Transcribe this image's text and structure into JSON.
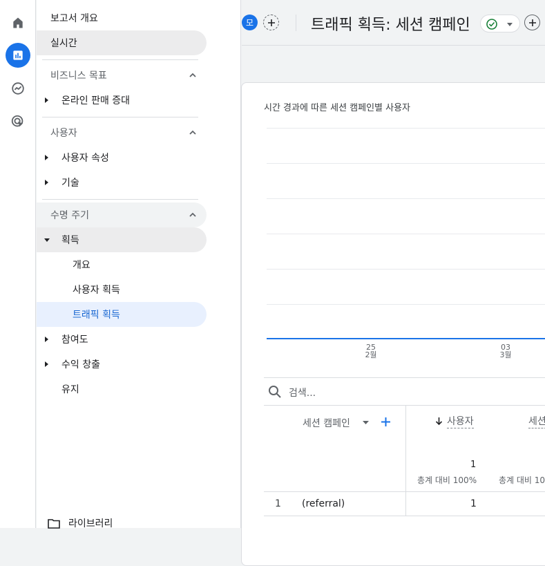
{
  "header": {
    "avatar_letter": "모",
    "title": "트래픽 획득: 세션 캠페인"
  },
  "sidebar": {
    "overview": "보고서 개요",
    "realtime": "실시간",
    "sections": [
      {
        "title": "비즈니스 목표",
        "items": [
          "온라인 판매 증대"
        ]
      },
      {
        "title": "사용자",
        "items": [
          "사용자 속성",
          "기술"
        ]
      },
      {
        "title": "수명 주기",
        "items": [
          "획득",
          "개요",
          "사용자 획득",
          "트래픽 획득",
          "참여도",
          "수익 창출",
          "유지"
        ]
      }
    ],
    "library": "라이브러리"
  },
  "chart": {
    "title": "시간 경과에 따른 세션 캠페인별 사용자",
    "ticks": [
      {
        "day": "25",
        "month": "2월"
      },
      {
        "day": "03",
        "month": "3월"
      }
    ]
  },
  "chart_data": {
    "type": "line",
    "title": "시간 경과에 따른 세션 캠페인별 사용자",
    "x_tick_labels": [
      "25 2월",
      "03 3월"
    ],
    "series": [
      {
        "values": [
          0,
          0,
          0
        ]
      }
    ],
    "grid": true
  },
  "table": {
    "search_placeholder": "검색...",
    "dimension_header": "세션 캠페인",
    "metric_header_1": "사용자",
    "metric_header_2": "세션",
    "total_value": "1",
    "total_pct": "총계 대비 100%",
    "total_pct_2": "총계 대비 10",
    "rows": [
      {
        "index": "1",
        "campaign": "(referral)",
        "users": "1"
      }
    ]
  },
  "colors": {
    "accent": "#1a73e8",
    "selected_bg": "#e8f0fe",
    "success": "#188038"
  }
}
